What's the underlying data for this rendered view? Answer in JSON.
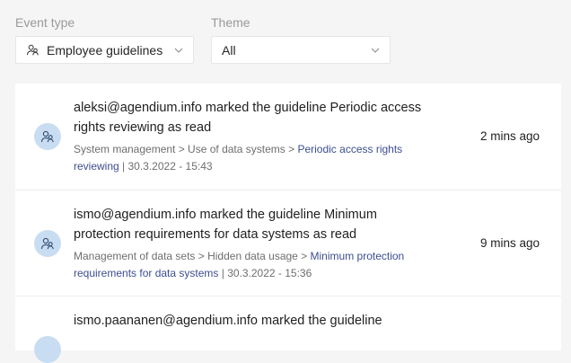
{
  "filters": {
    "event_type": {
      "label": "Event type",
      "value": "Employee guidelines",
      "icon": "employee-guidelines-icon"
    },
    "theme": {
      "label": "Theme",
      "value": "All"
    }
  },
  "feed": {
    "items": [
      {
        "title": "aleksi@agendium.info marked the guideline Periodic access rights reviewing as read",
        "path": "System management > Use of data systems > ",
        "link": "Periodic access rights reviewing",
        "date": " | 30.3.2022 - 15:43",
        "time": "2 mins ago",
        "icon": "employee-guidelines-icon"
      },
      {
        "title": "ismo@agendium.info marked the guideline Minimum protection requirements for data systems as read",
        "path": "Management of data sets > Hidden data usage > ",
        "link": "Minimum protection requirements for data systems",
        "date": " | 30.3.2022 - 15:36",
        "time": "9 mins ago",
        "icon": "employee-guidelines-icon"
      },
      {
        "title": "ismo.paananen@agendium.info marked the guideline",
        "icon": "employee-guidelines-icon"
      }
    ]
  },
  "colors": {
    "link": "#3d4e8f",
    "avatar_bg": "#c9ddf2",
    "page_bg": "#f5f5f5"
  }
}
